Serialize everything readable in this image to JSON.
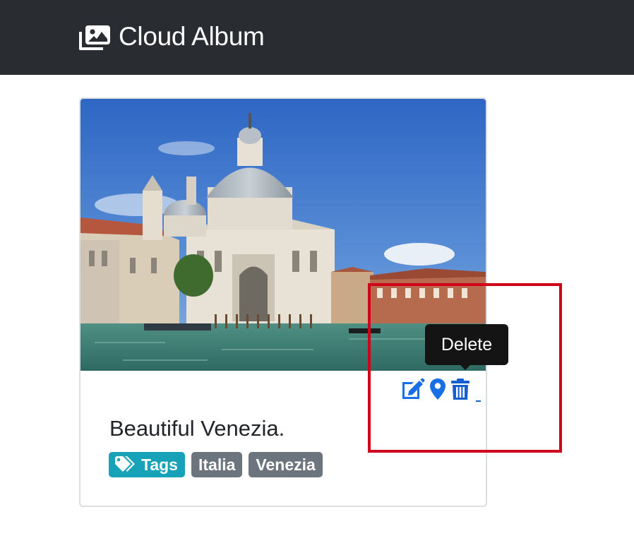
{
  "navbar": {
    "brand_icon": "images-icon",
    "brand_text": "Cloud Album"
  },
  "card": {
    "caption": "Beautiful Venezia.",
    "actions": [
      {
        "icon": "edit-icon",
        "color": "#1a6fe6"
      },
      {
        "icon": "map-marker-icon",
        "color": "#1a6fe6"
      },
      {
        "icon": "trash-icon",
        "color": "#1560d0"
      }
    ],
    "tags_label": "Tags",
    "tags": [
      "Italia",
      "Venezia"
    ]
  },
  "tooltip": {
    "text": "Delete"
  },
  "colors": {
    "navbar_bg": "#292c31",
    "link_blue": "#1a6fe6",
    "tag_info": "#17a2b8",
    "tag_secondary": "#6c757d",
    "highlight_red": "#d0021b"
  }
}
